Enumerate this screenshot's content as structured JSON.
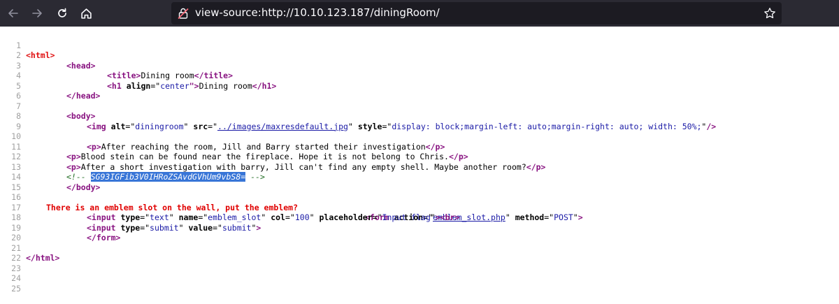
{
  "browser": {
    "url": "view-source:http://10.10.123.187/diningRoom/",
    "icons": [
      "back-arrow-icon",
      "forward-arrow-icon",
      "reload-icon",
      "home-icon",
      "lock-warning-icon",
      "bookmark-star-icon"
    ]
  },
  "source": {
    "line_numbers": [
      "1",
      "2",
      "3",
      "4",
      "5",
      "6",
      "7",
      "8",
      "9",
      "10",
      "11",
      "12",
      "13",
      "14",
      "15",
      "16",
      "17",
      "18",
      "19",
      "20",
      "21",
      "22",
      "23",
      "24",
      "25"
    ],
    "l1_tag": "<html>",
    "l2_tag": "<head>",
    "l3_open": "<title>",
    "l3_text": "Dining room",
    "l3_close": "</title>",
    "l4_open_el": "<h1",
    "l4_attr": "align",
    "l4_eq": "=\"",
    "l4_val": "center",
    "l4_q": "\">",
    "l4_text": "Dining room",
    "l4_close": "</h1>",
    "l5_tag": "</head>",
    "l7_tag": "<body>",
    "l8_el": "<img",
    "l8_a1": "alt",
    "l8_v1": "diningroom",
    "l8_a2": "src",
    "l8_v2": "../images/maxresdefault.jpg",
    "l8_a3": "style",
    "l8_v3": "display: block;margin-left: auto;margin-right: auto; width: 50%;",
    "l8_end": "/>",
    "l10_open": "<p>",
    "l10_text": "After reaching the room, Jill and Barry started their investigation",
    "l10_close": "</p>",
    "l11_open": "<p>",
    "l11_text": "Blood stein can be found near the fireplace. Hope it is not belong to Chris.",
    "l11_close": "</p>",
    "l12_open": "<p>",
    "l12_text": "After a short investigation with barry, Jill can't find any empty shell. Maybe another room?",
    "l12_close": "</p>",
    "l13_comment_open": "<!-- ",
    "l13_selected": "SG93IGFib3V0IHRoZSAvdGVhUm9vbS8=",
    "l13_comment_close": " -->",
    "l14_tag": "</body>",
    "l16_text": "There is an emblem slot on the wall, put the emblem?",
    "l16_form_el": "<form",
    "l16_a1": "action",
    "l16_v1": "emblem_slot.php",
    "l16_a2": "method",
    "l16_v2": "POST",
    "l17_el": "<input",
    "l17_a1": "type",
    "l17_v1": "text",
    "l17_a2": "name",
    "l17_v2": "emblem_slot",
    "l17_a3": "col",
    "l17_v3": "100",
    "l17_a4": "placeholder",
    "l17_v4": "Input flag",
    "l17_br": "<br>",
    "l18_el": "<input",
    "l18_a1": "type",
    "l18_v1": "submit",
    "l18_a2": "value",
    "l18_v2": "submit",
    "l19_tag": "</form>",
    "l21_tag": "</html>"
  }
}
